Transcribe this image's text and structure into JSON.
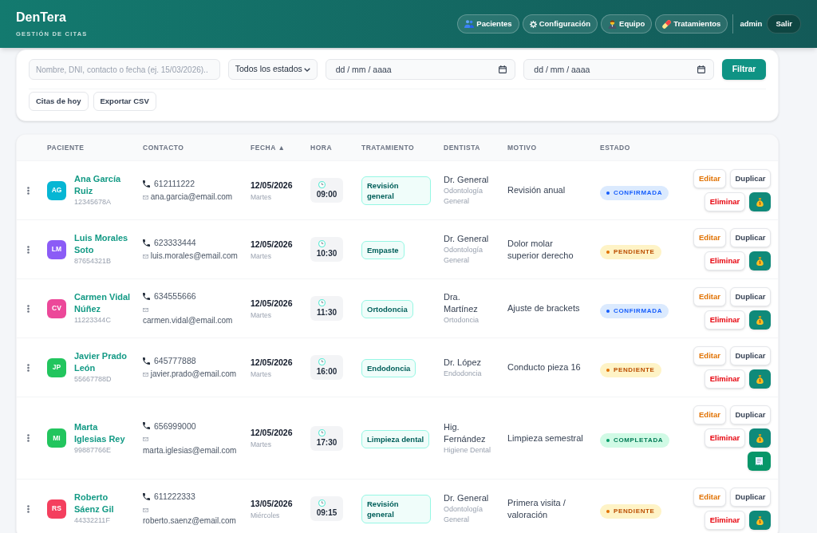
{
  "header": {
    "title": "DenTera",
    "subtitle": "GESTIÓN DE CITAS",
    "nav": [
      {
        "label": "Pacientes",
        "kind": "patients"
      },
      {
        "label": "Configuración",
        "kind": "settings"
      },
      {
        "label": "Equipo",
        "kind": "team"
      },
      {
        "label": "Tratamientos",
        "kind": "treatments"
      }
    ],
    "user": "admin",
    "logout": "Salir"
  },
  "filters": {
    "search": {
      "placeholder": "Nombre, DNI, contacto o fecha (ej. 15/03/2026).."
    },
    "status_select": {
      "value": "Todos los estados"
    },
    "date_from": {
      "placeholder": "dd / mm / aaaa"
    },
    "date_to": {
      "placeholder": "dd / mm / aaaa"
    },
    "filter_button": "Filtrar",
    "quick_buttons": [
      "Citas de hoy",
      "Exportar CSV"
    ]
  },
  "table": {
    "columns": [
      "PACIENTE",
      "CONTACTO",
      "FECHA ▲",
      "HORA",
      "TRATAMIENTO",
      "DENTISTA",
      "MOTIVO",
      "ESTADO"
    ],
    "rows": [
      {
        "initials": "AG",
        "color": "#06b6d4",
        "name": "Ana García Ruiz",
        "dni": "12345678A",
        "phone": "612111222",
        "email": "ana.garcia@email.com",
        "date": "12/05/2026",
        "weekday": "Martes",
        "time": "09:00",
        "treatment": "Revisión general",
        "dentist": "Dr. General",
        "specialty": "Odontología General",
        "reason": "Revisión anual",
        "status": {
          "label": "CONFIRMADA",
          "kind": "confirmed"
        },
        "actions": [
          {
            "kind": "edit",
            "label": "Editar"
          },
          {
            "kind": "duplicate",
            "label": "Duplicar"
          },
          {
            "kind": "delete",
            "label": "Eliminar"
          },
          {
            "kind": "payment"
          }
        ]
      },
      {
        "initials": "LM",
        "color": "#8b5cf6",
        "name": "Luis Morales Soto",
        "dni": "87654321B",
        "phone": "623333444",
        "email": "luis.morales@email.com",
        "date": "12/05/2026",
        "weekday": "Martes",
        "time": "10:30",
        "treatment": "Empaste",
        "dentist": "Dr. General",
        "specialty": "Odontología General",
        "reason": "Dolor molar superior derecho",
        "status": {
          "label": "PENDIENTE",
          "kind": "pending"
        },
        "actions": [
          {
            "kind": "edit",
            "label": "Editar"
          },
          {
            "kind": "duplicate",
            "label": "Duplicar"
          },
          {
            "kind": "delete",
            "label": "Eliminar"
          },
          {
            "kind": "payment"
          }
        ]
      },
      {
        "initials": "CV",
        "color": "#ec4899",
        "name": "Carmen Vidal Núñez",
        "dni": "11223344C",
        "phone": "634555666",
        "email": "carmen.vidal@email.com",
        "date": "12/05/2026",
        "weekday": "Martes",
        "time": "11:30",
        "treatment": "Ortodoncia",
        "dentist": "Dra. Martínez",
        "specialty": "Ortodoncia",
        "reason": "Ajuste de brackets",
        "status": {
          "label": "CONFIRMADA",
          "kind": "confirmed"
        },
        "actions": [
          {
            "kind": "edit",
            "label": "Editar"
          },
          {
            "kind": "duplicate",
            "label": "Duplicar"
          },
          {
            "kind": "delete",
            "label": "Eliminar"
          },
          {
            "kind": "payment"
          }
        ]
      },
      {
        "initials": "JP",
        "color": "#22c55e",
        "name": "Javier Prado León",
        "dni": "55667788D",
        "phone": "645777888",
        "email": "javier.prado@email.com",
        "date": "12/05/2026",
        "weekday": "Martes",
        "time": "16:00",
        "treatment": "Endodoncia",
        "dentist": "Dr. López",
        "specialty": "Endodoncia",
        "reason": "Conducto pieza 16",
        "status": {
          "label": "PENDIENTE",
          "kind": "pending"
        },
        "actions": [
          {
            "kind": "edit",
            "label": "Editar"
          },
          {
            "kind": "duplicate",
            "label": "Duplicar"
          },
          {
            "kind": "delete",
            "label": "Eliminar"
          },
          {
            "kind": "payment"
          }
        ]
      },
      {
        "initials": "MI",
        "color": "#22c55e",
        "name": "Marta Iglesias Rey",
        "dni": "99887766E",
        "phone": "656999000",
        "email": "marta.iglesias@email.com",
        "date": "12/05/2026",
        "weekday": "Martes",
        "time": "17:30",
        "treatment": "Limpieza dental",
        "dentist": "Hig. Fernández",
        "specialty": "Higiene Dental",
        "reason": "Limpieza semestral",
        "status": {
          "label": "COMPLETADA",
          "kind": "completed"
        },
        "actions": [
          {
            "kind": "edit",
            "label": "Editar"
          },
          {
            "kind": "duplicate",
            "label": "Duplicar"
          },
          {
            "kind": "delete",
            "label": "Eliminar"
          },
          {
            "kind": "payment"
          },
          {
            "kind": "invoice"
          }
        ]
      },
      {
        "initials": "RS",
        "color": "#f43f5e",
        "name": "Roberto Sáenz Gil",
        "dni": "44332211F",
        "phone": "611222333",
        "email": "roberto.saenz@email.com",
        "date": "13/05/2026",
        "weekday": "Miércoles",
        "time": "09:15",
        "treatment": "Revisión general",
        "dentist": "Dr. General",
        "specialty": "Odontología General",
        "reason": "Primera visita / valoración",
        "status": {
          "label": "PENDIENTE",
          "kind": "pending"
        },
        "actions": [
          {
            "kind": "edit",
            "label": "Editar"
          },
          {
            "kind": "duplicate",
            "label": "Duplicar"
          },
          {
            "kind": "delete",
            "label": "Eliminar"
          },
          {
            "kind": "payment"
          }
        ]
      }
    ]
  }
}
